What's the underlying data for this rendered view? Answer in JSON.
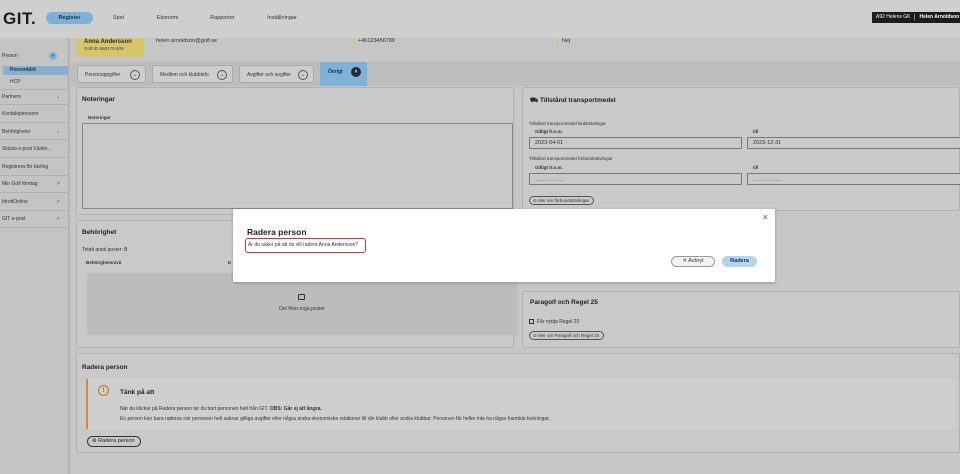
{
  "header": {
    "logo": "GIT.",
    "nav": [
      "Register",
      "Spel",
      "Ekonomi",
      "Rapporter",
      "Inställningar"
    ],
    "club": "A92 Helens GK",
    "user": "Helen Arnoldson"
  },
  "sidebar": {
    "section": "Person",
    "collapse_icon": "chevron-up-icon",
    "sub_items": [
      "Personbild",
      "HCP"
    ],
    "items": [
      {
        "label": "Partners",
        "icon": "chevron-down-icon"
      },
      {
        "label": "Kontaktpersoner",
        "icon": ""
      },
      {
        "label": "Behörigheter",
        "icon": "chevron-down-icon"
      },
      {
        "label": "Skicka e-post Vänlin...",
        "icon": ""
      },
      {
        "label": "Registrera för tävling",
        "icon": ""
      },
      {
        "label": "Min Golf företag",
        "icon": "external-link-icon"
      },
      {
        "label": "IdrottOnline",
        "icon": "external-link-icon"
      },
      {
        "label": "GIT e-post",
        "icon": "external-link-icon"
      }
    ]
  },
  "person": {
    "name": "Anna Andersson",
    "golf_id": "Golf-ID 556173-505",
    "email": "helen.arnoldson@golf.se",
    "phone": "+46123456789",
    "flag": "Nej"
  },
  "tabs": [
    "Personuppgifter",
    "Medlem och klubbinfo",
    "Avgifter och avgifter",
    "Övrigt"
  ],
  "notes": {
    "title": "Noteringar",
    "field_label": "Noteringar"
  },
  "transport": {
    "title": "Tillstånd transportmedel",
    "club_section": "Tillstånd transportmedel klubbtävlingar",
    "federation_section": "Tillstånd transportmedel förbundstävlingar",
    "from_label": "Giltigt fr.o.m.",
    "to_label": "till",
    "club_from": "2023-04-01",
    "club_to": "2023-12-31",
    "fed_from_placeholder": "____-__-__",
    "fed_to_placeholder": "____-__-__",
    "more_link": "Mer om förbundstävlingar"
  },
  "permissions": {
    "title": "Behörighet",
    "total_label": "Totalt antal poster:",
    "total_value": "0",
    "col_label": "Behörighetsnivå",
    "col_label2": "E",
    "empty_text": "Det finns inga poster"
  },
  "paragolf": {
    "title": "Paragolf och Regel 25",
    "checkbox_label": "Får nyttja Regel 25",
    "more_link": "Mer om Paragolf och Regel 25"
  },
  "delete_section": {
    "title": "Radera person",
    "warn_title": "Tänk på att",
    "warn_line1_a": "När du klickar på Radera person tar du bort personen helt från GIT.",
    "warn_line1_b": "OBS: Går ej att ångra.",
    "warn_line2": "En person kan bara raderas när personen helt saknar giltiga avgifter eller några andra ekonomiska relationer till din klubb eller andra klubbar. Personen får heller inte ha några framtida bokningar.",
    "button": "Radera person"
  },
  "modal": {
    "title": "Radera person",
    "message": "Är du säker på att du vill radera Anna Andersson?",
    "cancel": "Avbryt",
    "confirm": "Radera"
  },
  "colors": {
    "accent": "#7fb0d8",
    "warning": "#d08a4d",
    "highlight": "#d9342b",
    "name_card": "#d8c46b"
  }
}
